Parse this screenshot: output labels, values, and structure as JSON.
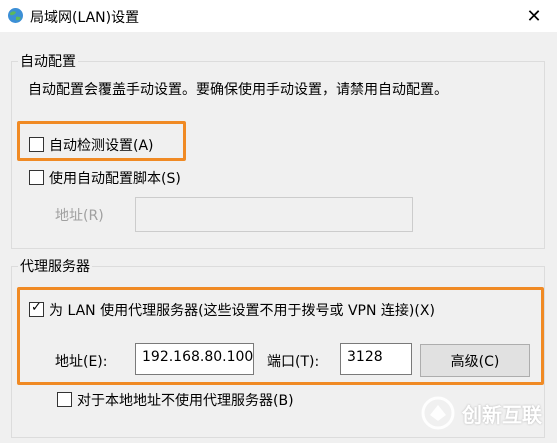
{
  "window": {
    "title": "局域网(LAN)设置",
    "close_glyph": "✕"
  },
  "auto_config": {
    "legend": "自动配置",
    "description": "自动配置会覆盖手动设置。要确保使用手动设置，请禁用自动配置。",
    "auto_detect": {
      "label": "自动检测设置(A)",
      "checked": false
    },
    "use_script": {
      "label": "使用自动配置脚本(S)",
      "checked": false
    },
    "address_label": "地址(R)",
    "address_value": ""
  },
  "proxy": {
    "legend": "代理服务器",
    "use_proxy": {
      "label": "为 LAN 使用代理服务器(这些设置不用于拨号或 VPN 连接)(X)",
      "checked": true,
      "check_glyph": "✓"
    },
    "address_label": "地址(E):",
    "address_value": "192.168.80.100",
    "port_label": "端口(T):",
    "port_value": "3128",
    "advanced_label": "高级(C)",
    "bypass_local": {
      "label": "对于本地地址不使用代理服务器(B)",
      "checked": false
    }
  },
  "watermark": {
    "text": "创新互联"
  },
  "colors": {
    "highlight": "#f08a24",
    "dialog_bg": "#f0f0f0"
  }
}
